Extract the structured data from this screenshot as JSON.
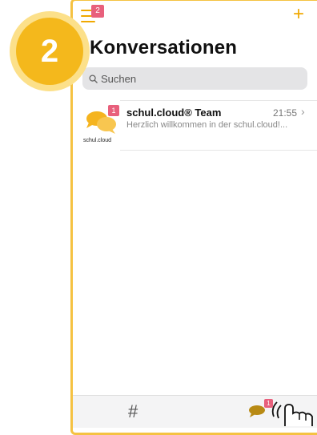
{
  "header": {
    "menu_badge": "2",
    "title": "Konversationen"
  },
  "search": {
    "placeholder": "Suchen"
  },
  "conversations": [
    {
      "name": "schul.cloud® Team",
      "time": "21:55",
      "preview": "Herzlich willkommen in der schul.cloud!...",
      "badge": "1",
      "logo_text": "schul.cloud"
    }
  ],
  "tabbar": {
    "hash_label": "#",
    "chat_badge": "1"
  },
  "step_marker": "2",
  "colors": {
    "accent": "#f0a800",
    "badge": "#e8607c",
    "step": "#f4b81c"
  }
}
